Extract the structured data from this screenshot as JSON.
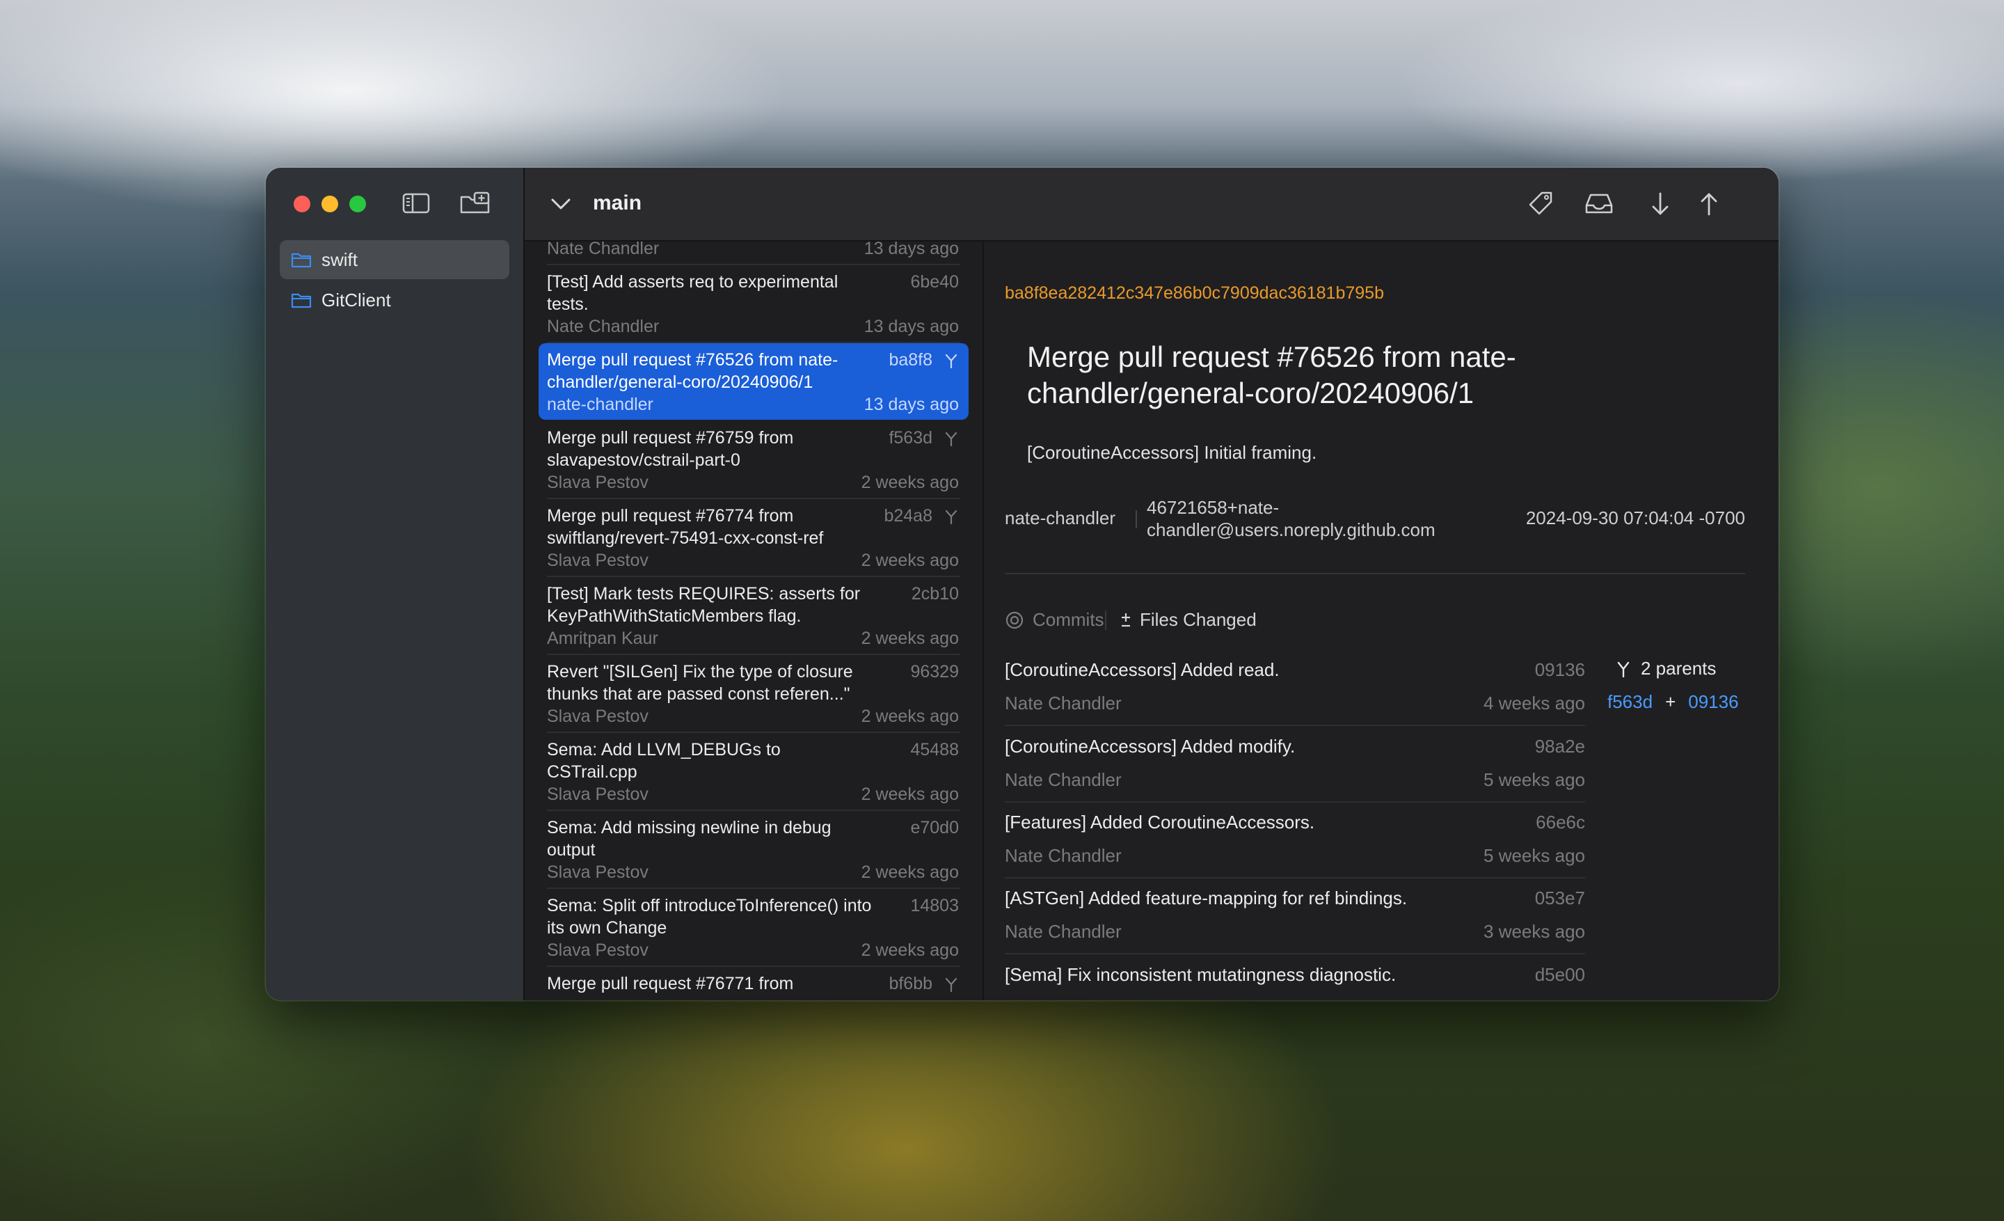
{
  "repositories": [
    {
      "name": "swift",
      "selected": true
    },
    {
      "name": "GitClient",
      "selected": false
    }
  ],
  "toolbar": {
    "branch": "main",
    "icons": [
      "tag-icon",
      "tray-icon",
      "pull-arrow-icon",
      "push-arrow-icon"
    ]
  },
  "commits": [
    {
      "message": "",
      "hash": "",
      "author": "Nate Chandler",
      "time": "13 days ago",
      "merge": false
    },
    {
      "message": "[Test] Add asserts req to experimental tests.",
      "hash": "6be40",
      "author": "Nate Chandler",
      "time": "13 days ago",
      "merge": false
    },
    {
      "message": "Merge pull request #76526 from nate-chandler/general-coro/20240906/1",
      "hash": "ba8f8",
      "author": "nate-chandler",
      "time": "13 days ago",
      "merge": true,
      "selected": true
    },
    {
      "message": "Merge pull request #76759 from slavapestov/cstrail-part-0",
      "hash": "f563d",
      "author": "Slava Pestov",
      "time": "2 weeks ago",
      "merge": true
    },
    {
      "message": "Merge pull request #76774 from swiftlang/revert-75491-cxx-const-ref",
      "hash": "b24a8",
      "author": "Slava Pestov",
      "time": "2 weeks ago",
      "merge": true
    },
    {
      "message": "[Test] Mark tests REQUIRES: asserts for KeyPathWithStaticMembers flag.",
      "hash": "2cb10",
      "author": "Amritpan Kaur",
      "time": "2 weeks ago",
      "merge": false
    },
    {
      "message": "Revert \"[SILGen] Fix the type of closure thunks that are passed const referen...\"",
      "hash": "96329",
      "author": "Slava Pestov",
      "time": "2 weeks ago",
      "merge": false
    },
    {
      "message": "Sema: Add LLVM_DEBUGs to CSTrail.cpp",
      "hash": "45488",
      "author": "Slava Pestov",
      "time": "2 weeks ago",
      "merge": false
    },
    {
      "message": "Sema: Add missing newline in debug output",
      "hash": "e70d0",
      "author": "Slava Pestov",
      "time": "2 weeks ago",
      "merge": false
    },
    {
      "message": "Sema: Split off introduceToInference() into its own Change",
      "hash": "14803",
      "author": "Slava Pestov",
      "time": "2 weeks ago",
      "merge": false
    },
    {
      "message": "Merge pull request #76771 from",
      "hash": "bf6bb",
      "author": "",
      "time": "",
      "merge": true
    }
  ],
  "detail": {
    "full_hash": "ba8f8ea282412c347e86b0c7909dac36181b795b",
    "title": "Merge pull request #76526 from nate-chandler/general-coro/20240906/1",
    "body": "[CoroutineAccessors] Initial framing.",
    "author": "nate-chandler",
    "email": "46721658+nate-chandler@users.noreply.github.com",
    "date": "2024-09-30 07:04:04 -0700",
    "tabs": {
      "commits": "Commits",
      "files": "Files Changed"
    },
    "parents_label": "2 parents",
    "parents": [
      "f563d",
      "09136"
    ],
    "plus": "+",
    "sub_commits": [
      {
        "message": "[CoroutineAccessors] Added read.",
        "hash": "09136",
        "author": "Nate Chandler",
        "time": "4 weeks ago"
      },
      {
        "message": "[CoroutineAccessors] Added modify.",
        "hash": "98a2e",
        "author": "Nate Chandler",
        "time": "5 weeks ago"
      },
      {
        "message": "[Features] Added CoroutineAccessors.",
        "hash": "66e6c",
        "author": "Nate Chandler",
        "time": "5 weeks ago"
      },
      {
        "message": "[ASTGen] Added feature-mapping for ref bindings.",
        "hash": "053e7",
        "author": "Nate Chandler",
        "time": "3 weeks ago"
      },
      {
        "message": "[Sema] Fix inconsistent mutatingness diagnostic.",
        "hash": "d5e00",
        "author": "",
        "time": ""
      }
    ]
  }
}
